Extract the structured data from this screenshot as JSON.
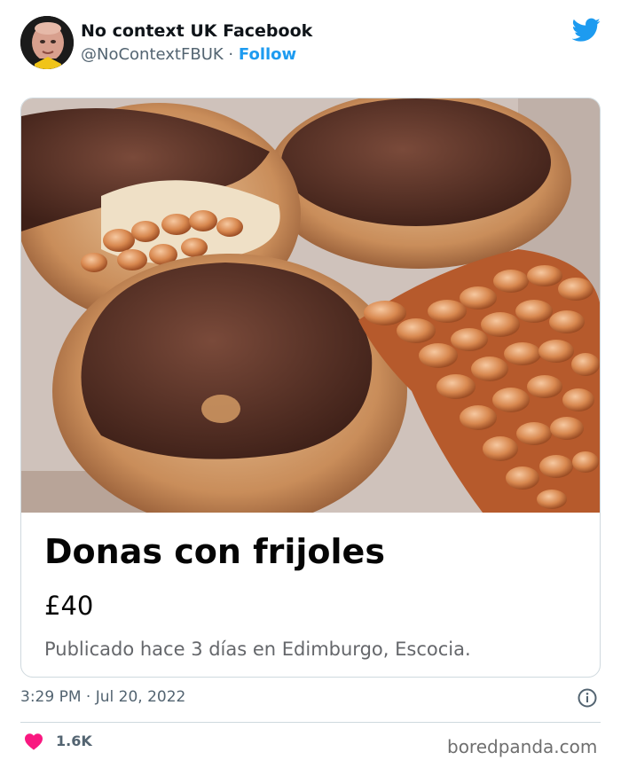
{
  "tweet": {
    "display_name": "No context UK Facebook",
    "handle": "@NoContextFBUK",
    "separator": "·",
    "follow_label": "Follow",
    "timestamp": "3:29 PM · Jul 20, 2022",
    "like_count": "1.6K"
  },
  "listing": {
    "title": "Donas con frijoles",
    "price": "£40",
    "meta": "Publicado hace 3 días en Edimburgo, Escocia."
  },
  "watermark": "boredpanda.com",
  "icons": {
    "brand": "twitter-bird-icon",
    "info": "info-icon",
    "like": "heart-icon"
  },
  "colors": {
    "accent": "#1d9bf0",
    "like": "#f91880",
    "muted": "#536471"
  }
}
